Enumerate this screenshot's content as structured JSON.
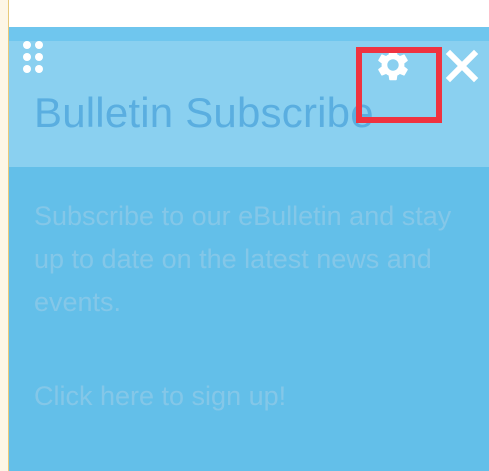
{
  "widget": {
    "title": "Bulletin Subscribe",
    "body": "Subscribe to our eBulletin and stay up to date on the latest news and events.",
    "link_label": "Click here to sign up!",
    "icons": {
      "drag": "drag-handle-icon",
      "settings": "gear-icon",
      "close": "close-icon"
    }
  },
  "colors": {
    "widget_background": "#63bfe9",
    "header_background": "#8ad0f0",
    "icon_color": "#ffffff",
    "highlight": "#ef3340"
  }
}
